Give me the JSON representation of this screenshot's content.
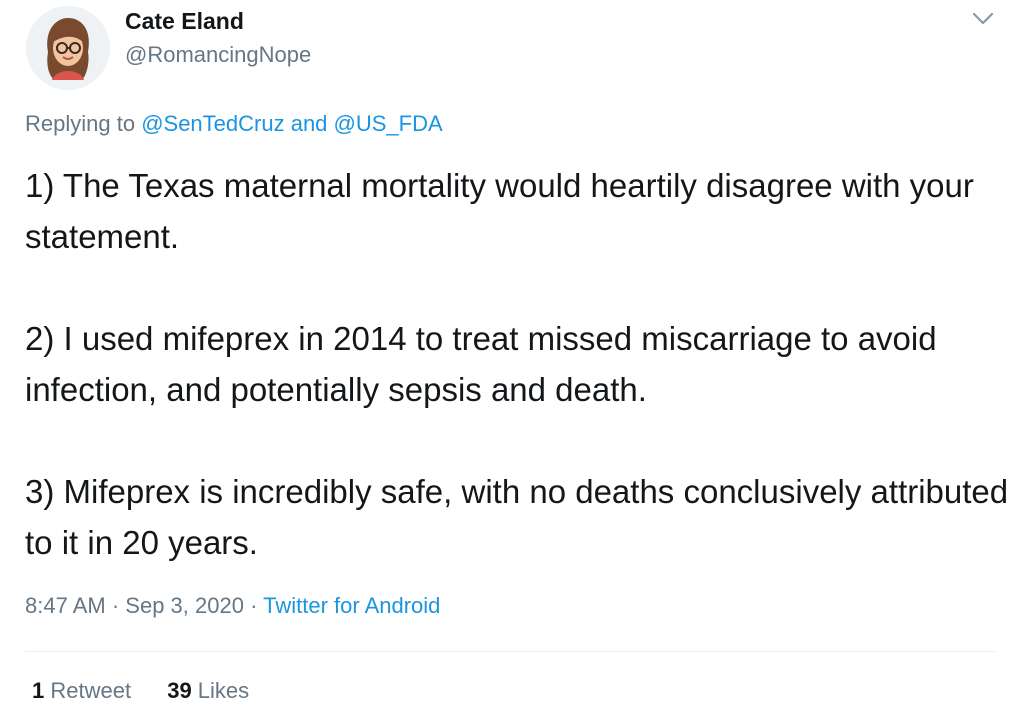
{
  "user": {
    "name": "Cate Eland",
    "handle": "@RomancingNope"
  },
  "reply": {
    "prefix": "Replying to ",
    "mention_1": "@SenTedCruz",
    "joiner": " and ",
    "mention_2": "@US_FDA"
  },
  "tweet": {
    "paragraphs": [
      "1) The Texas maternal mortality would heartily disagree with your statement.",
      "2) I used mifeprex in 2014 to treat missed miscarriage to avoid infection, and potentially sepsis and death.",
      "3) Mifeprex is incredibly safe, with no deaths conclusively attributed to it in 20 years."
    ]
  },
  "meta": {
    "time": "8:47 AM",
    "sep1": " · ",
    "date": "Sep 3, 2020",
    "sep2": " · ",
    "source": "Twitter for Android"
  },
  "stats": {
    "retweets_count": "1",
    "retweets_label": " Retweet",
    "likes_count": "39",
    "likes_label": " Likes"
  },
  "icons": {
    "menu": "chevron-down-icon",
    "avatar": "bitmoji-avatar"
  },
  "colors": {
    "link": "#1b95e0",
    "secondary": "#657786",
    "primary": "#14171a"
  }
}
